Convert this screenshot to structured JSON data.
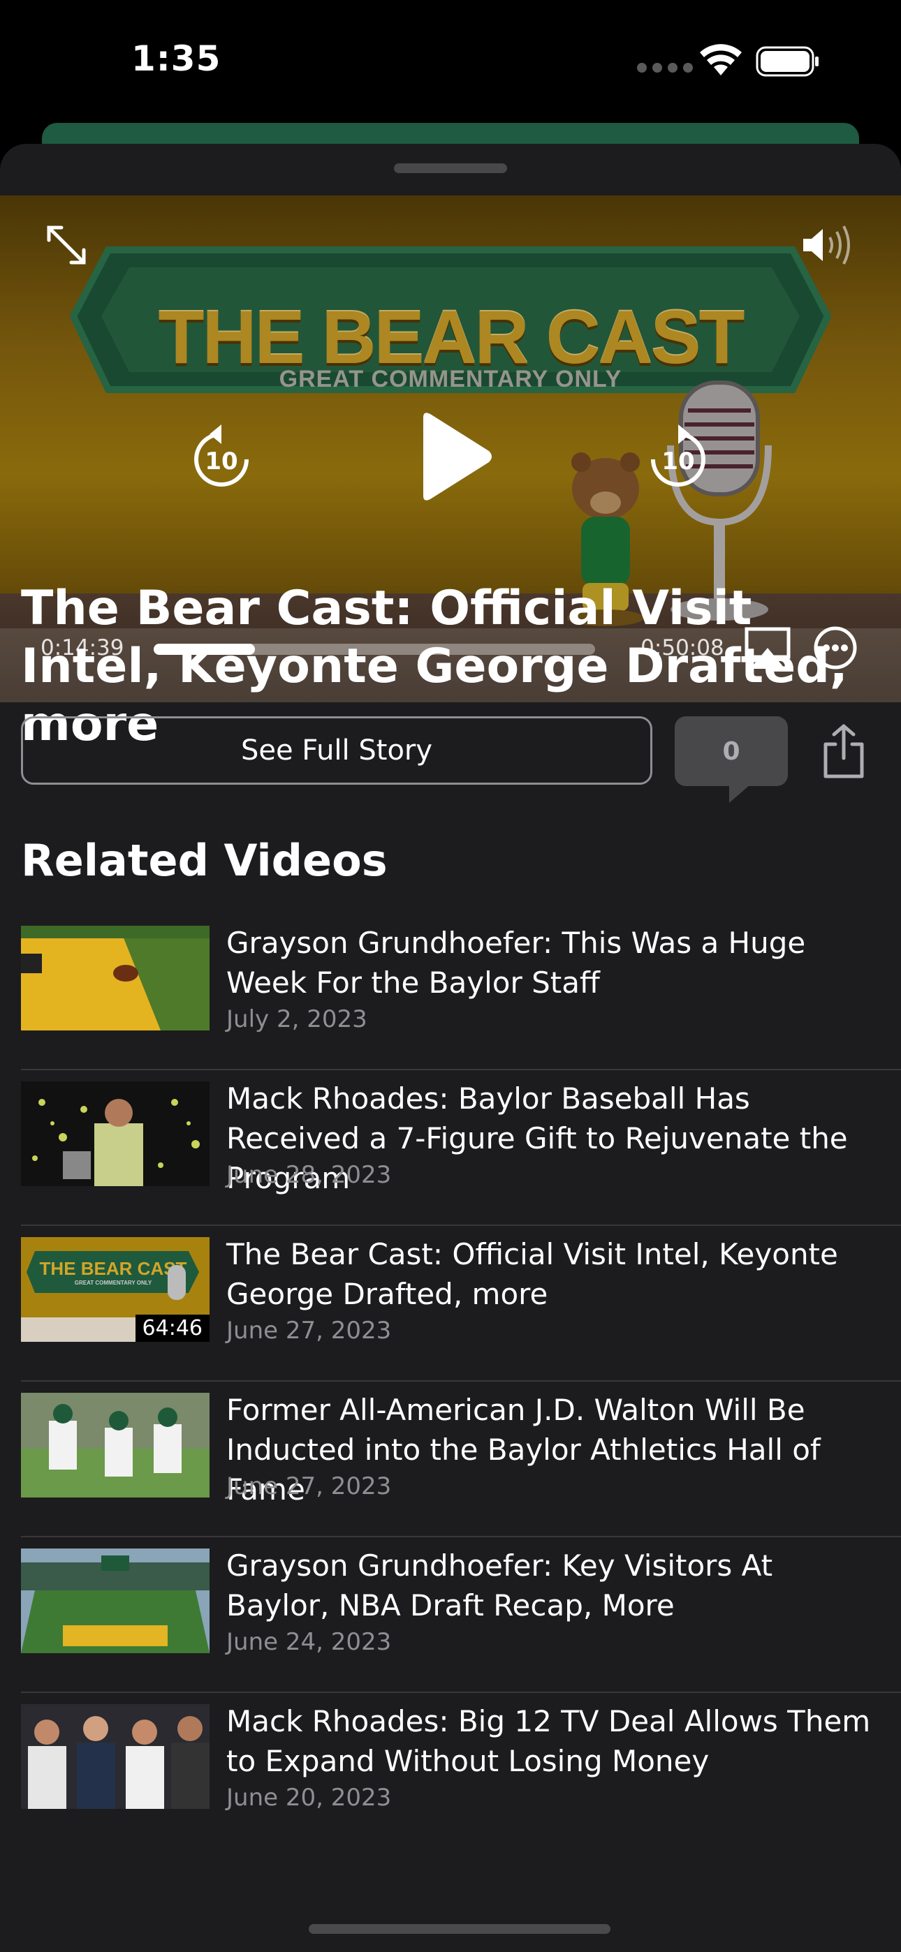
{
  "status_bar": {
    "time": "1:35"
  },
  "player": {
    "banner_title": "THE BEAR CAST",
    "banner_subtitle": "GREAT COMMENTARY ONLY",
    "elapsed": "0:14:39",
    "remaining": "-0:50:08",
    "progress_fraction": 0.23,
    "skip_back_seconds": "10",
    "skip_forward_seconds": "10"
  },
  "video": {
    "title": "The Bear Cast: Official Visit Intel, Keyonte George Drafted, more",
    "see_full_story": "See Full Story",
    "comment_count": "0"
  },
  "related": {
    "heading": "Related Videos",
    "items": [
      {
        "title": "Grayson Grundhoefer: This Was a Huge Week For the Baylor Staff",
        "date": "July 2, 2023",
        "thumb": "football-field"
      },
      {
        "title": "Mack Rhoades: Baylor Baseball Has Received a 7-Figure Gift to Rejuvenate the Program",
        "date": "June 28, 2023",
        "thumb": "confetti-speaker"
      },
      {
        "title": "The Bear Cast: Official Visit Intel, Keyonte George Drafted, more",
        "date": "June 27, 2023",
        "thumb": "bear-cast",
        "duration": "64:46"
      },
      {
        "title": "Former All-American  J.D. Walton Will Be Inducted into the Baylor Athletics Hall of Fame",
        "date": "June 27, 2023",
        "thumb": "practice"
      },
      {
        "title": "Grayson Grundhoefer: Key Visitors At Baylor, NBA Draft Recap, More",
        "date": "June 24, 2023",
        "thumb": "stadium"
      },
      {
        "title": "Mack Rhoades: Big 12 TV Deal Allows Them to Expand Without Losing Money",
        "date": "June 20, 2023",
        "thumb": "crowd"
      }
    ]
  }
}
